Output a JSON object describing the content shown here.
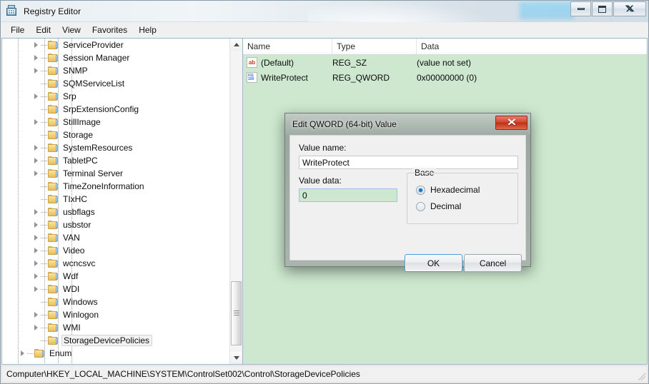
{
  "window": {
    "title": "Registry Editor",
    "icon": "registry-editor-icon",
    "buttons": {
      "minimize": "Minimize",
      "maximize": "Maximize",
      "close": "Close"
    }
  },
  "menubar": {
    "items": [
      {
        "label": "File"
      },
      {
        "label": "Edit"
      },
      {
        "label": "View"
      },
      {
        "label": "Favorites"
      },
      {
        "label": "Help"
      }
    ]
  },
  "tree": {
    "items": [
      {
        "label": "ServiceProvider",
        "expandable": true,
        "indent": 3,
        "selected": false
      },
      {
        "label": "Session Manager",
        "expandable": true,
        "indent": 3,
        "selected": false
      },
      {
        "label": "SNMP",
        "expandable": true,
        "indent": 3,
        "selected": false
      },
      {
        "label": "SQMServiceList",
        "expandable": false,
        "indent": 3,
        "selected": false
      },
      {
        "label": "Srp",
        "expandable": true,
        "indent": 3,
        "selected": false
      },
      {
        "label": "SrpExtensionConfig",
        "expandable": false,
        "indent": 3,
        "selected": false
      },
      {
        "label": "StillImage",
        "expandable": true,
        "indent": 3,
        "selected": false
      },
      {
        "label": "Storage",
        "expandable": false,
        "indent": 3,
        "selected": false
      },
      {
        "label": "SystemResources",
        "expandable": true,
        "indent": 3,
        "selected": false
      },
      {
        "label": "TabletPC",
        "expandable": true,
        "indent": 3,
        "selected": false
      },
      {
        "label": "Terminal Server",
        "expandable": true,
        "indent": 3,
        "selected": false
      },
      {
        "label": "TimeZoneInformation",
        "expandable": false,
        "indent": 3,
        "selected": false
      },
      {
        "label": "TIxHC",
        "expandable": false,
        "indent": 3,
        "selected": false
      },
      {
        "label": "usbflags",
        "expandable": true,
        "indent": 3,
        "selected": false
      },
      {
        "label": "usbstor",
        "expandable": true,
        "indent": 3,
        "selected": false
      },
      {
        "label": "VAN",
        "expandable": true,
        "indent": 3,
        "selected": false
      },
      {
        "label": "Video",
        "expandable": true,
        "indent": 3,
        "selected": false
      },
      {
        "label": "wcncsvc",
        "expandable": true,
        "indent": 3,
        "selected": false
      },
      {
        "label": "Wdf",
        "expandable": true,
        "indent": 3,
        "selected": false
      },
      {
        "label": "WDI",
        "expandable": true,
        "indent": 3,
        "selected": false
      },
      {
        "label": "Windows",
        "expandable": false,
        "indent": 3,
        "selected": false
      },
      {
        "label": "Winlogon",
        "expandable": true,
        "indent": 3,
        "selected": false
      },
      {
        "label": "WMI",
        "expandable": true,
        "indent": 3,
        "selected": false
      },
      {
        "label": "StorageDevicePolicies",
        "expandable": false,
        "indent": 3,
        "selected": true
      },
      {
        "label": "Enum",
        "expandable": true,
        "indent": 2,
        "selected": false
      }
    ],
    "scrollbar": {
      "up_arrow": "scroll-up",
      "down_arrow": "scroll-down"
    }
  },
  "list": {
    "columns": [
      {
        "label": "Name"
      },
      {
        "label": "Type"
      },
      {
        "label": "Data"
      }
    ],
    "rows": [
      {
        "icon": "string-value-icon",
        "icon_text": "ab",
        "name": "(Default)",
        "type": "REG_SZ",
        "data": "(value not set)"
      },
      {
        "icon": "binary-value-icon",
        "icon_text": "",
        "name": "WriteProtect",
        "type": "REG_QWORD",
        "data": "0x00000000 (0)"
      }
    ]
  },
  "statusbar": {
    "path": "Computer\\HKEY_LOCAL_MACHINE\\SYSTEM\\ControlSet002\\Control\\StorageDevicePolicies"
  },
  "dialog": {
    "title": "Edit QWORD (64-bit) Value",
    "close_label": "Close",
    "value_name_label": "Value name:",
    "value_name": "WriteProtect",
    "value_data_label": "Value data:",
    "value_data": "0",
    "base": {
      "legend": "Base",
      "options": [
        {
          "label": "Hexadecimal",
          "checked": true
        },
        {
          "label": "Decimal",
          "checked": false
        }
      ]
    },
    "ok_label": "OK",
    "cancel_label": "Cancel"
  },
  "colors": {
    "list_background": "#cde8cf",
    "selected_field": "#cde8cf",
    "accent_focus": "#4a9ad8",
    "close_button": "#bc2f18",
    "radio_dot": "#1b6fc4"
  }
}
